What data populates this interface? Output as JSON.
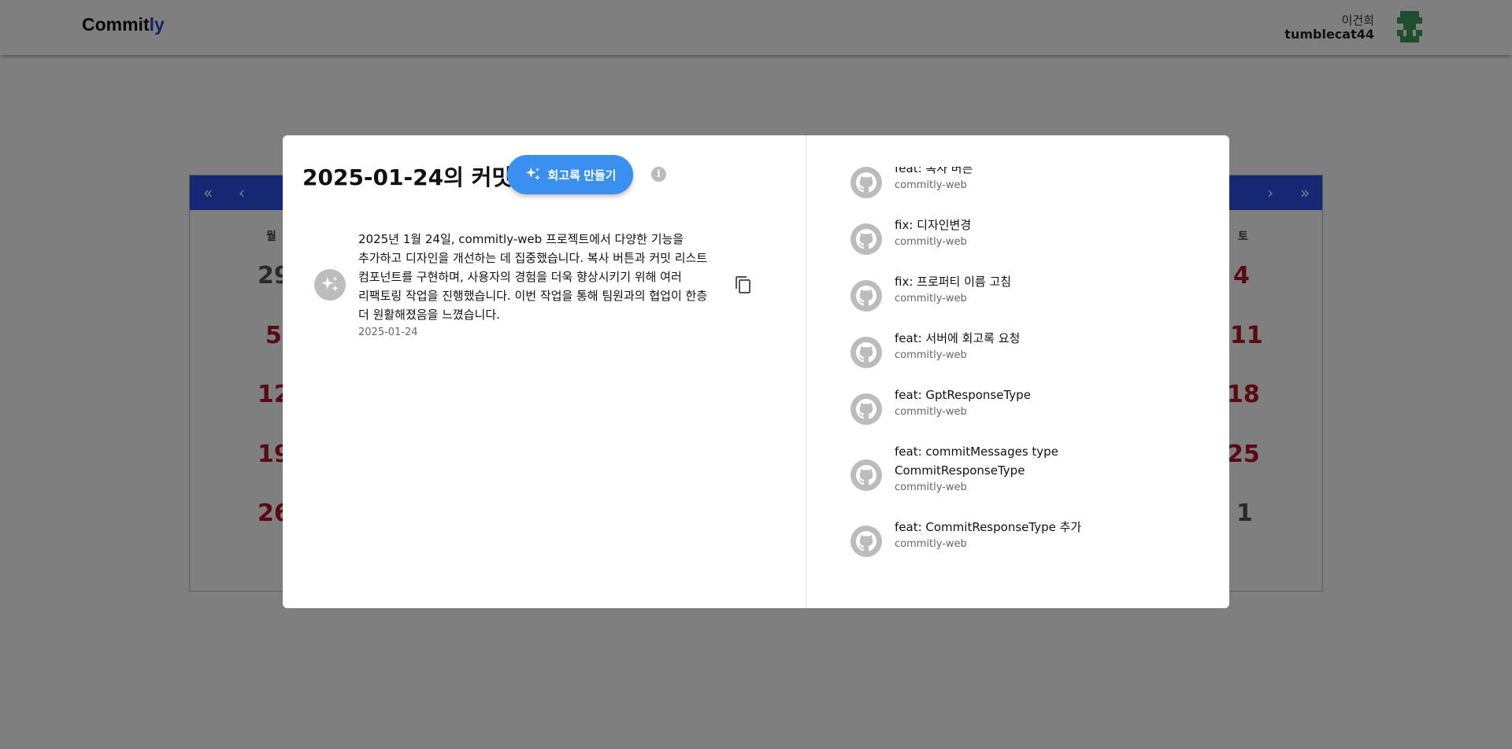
{
  "header": {
    "logo_main": "Commit",
    "logo_accent": "ly",
    "user_name": "이건희",
    "user_id": "tumblecat44"
  },
  "calendar": {
    "nav": {
      "first": "«",
      "prev": "‹",
      "next": "›",
      "last": "»"
    },
    "dow_left": "월",
    "dow_right": "토",
    "left_days": [
      "29",
      "5",
      "12",
      "19",
      "26"
    ],
    "right_days": [
      "4",
      "11",
      "18",
      "25",
      "1"
    ]
  },
  "modal": {
    "title": "2025-01-24의 커밋",
    "retro_button_label": "회고록 만들기",
    "info_icon": "i",
    "retrospective": {
      "text": "2025년 1월 24일, commitly-web 프로젝트에서 다양한 기능을 추가하고 디자인을 개선하는 데 집중했습니다. 복사 버튼과 커밋 리스트 컴포넌트를 구현하며, 사용자의 경험을 더욱 향상시키기 위해 여러 리팩토링 작업을 진행했습니다. 이번 작업을 통해 팀원과의 협업이 한층 더 원활해졌음을 느꼈습니다.",
      "date": "2025-01-24"
    },
    "commits": [
      {
        "message": "feat: 복사 버튼",
        "repo": "commitly-web"
      },
      {
        "message": "fix: 디자인변경",
        "repo": "commitly-web"
      },
      {
        "message": "fix: 프로퍼티 이름 고침",
        "repo": "commitly-web"
      },
      {
        "message": "feat: 서버에 회고록 요청",
        "repo": "commitly-web"
      },
      {
        "message": "feat: GptResponseType",
        "repo": "commitly-web"
      },
      {
        "message": "feat: commitMessages type CommitResponseType",
        "repo": "commitly-web"
      },
      {
        "message": "feat: CommitResponseType 추가",
        "repo": "commitly-web"
      }
    ]
  },
  "colors": {
    "brand_accent": "#2747d4",
    "calendar_nav": "#2d4fe6",
    "button_primary": "#3b8ff0",
    "weekend_red": "#b31426"
  }
}
